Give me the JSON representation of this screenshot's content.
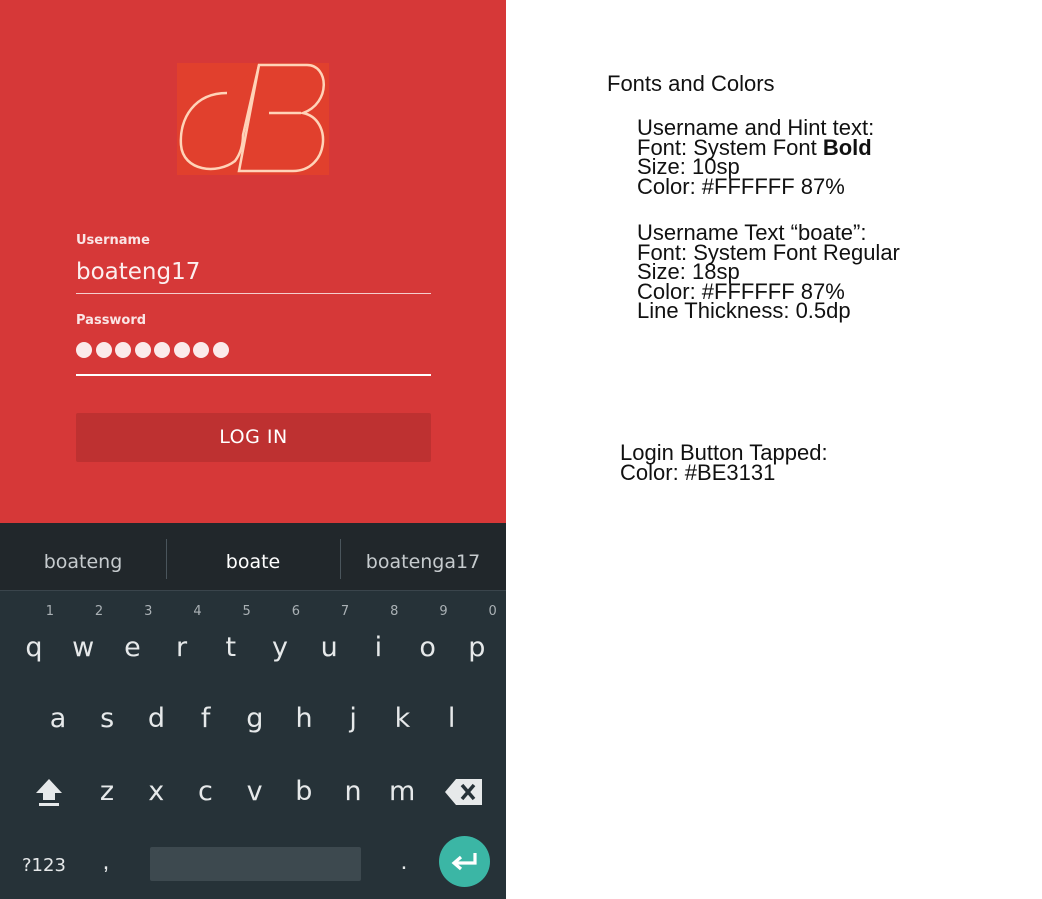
{
  "login": {
    "username_label": "Username",
    "username_value": "boateng17",
    "password_label": "Password",
    "password_dot_count": 8,
    "login_button_label": "LOG IN",
    "colors": {
      "background": "#D63838",
      "button_tapped": "#BE3131",
      "logo_background": "#E1402D",
      "logo_stroke": "#FFD3B8"
    }
  },
  "keyboard": {
    "suggestions": [
      "boateng",
      "boate",
      "boatenga17"
    ],
    "row1": [
      {
        "key": "q",
        "hint": "1"
      },
      {
        "key": "w",
        "hint": "2"
      },
      {
        "key": "e",
        "hint": "3"
      },
      {
        "key": "r",
        "hint": "4"
      },
      {
        "key": "t",
        "hint": "5"
      },
      {
        "key": "y",
        "hint": "6"
      },
      {
        "key": "u",
        "hint": "7"
      },
      {
        "key": "i",
        "hint": "8"
      },
      {
        "key": "o",
        "hint": "9"
      },
      {
        "key": "p",
        "hint": "0"
      }
    ],
    "row2": [
      "a",
      "s",
      "d",
      "f",
      "g",
      "h",
      "j",
      "k",
      "l"
    ],
    "row3": [
      "z",
      "x",
      "c",
      "v",
      "b",
      "n",
      "m"
    ],
    "symbols_label": "?123",
    "comma_label": ",",
    "period_label": ".",
    "icons": {
      "shift": "shift-icon",
      "backspace": "backspace-icon",
      "enter": "enter-icon"
    },
    "colors": {
      "background": "#263238",
      "enter": "#3BB6A5"
    }
  },
  "notes": {
    "title": "Fonts and Colors",
    "hint_heading": "Username and Hint text:",
    "hint_font_prefix": "Font: System Font ",
    "hint_font_bold": "Bold",
    "hint_size": "Size: 10sp",
    "hint_color": "Color: #FFFFFF 87%",
    "text_heading": "Username Text “boate”:",
    "text_font": "Font: System Font Regular",
    "text_size": "Size: 18sp",
    "text_color": "Color: #FFFFFF 87%",
    "text_line": "Line Thickness: 0.5dp",
    "login_heading": "Login Button Tapped:",
    "login_color": "Color: #BE3131"
  }
}
